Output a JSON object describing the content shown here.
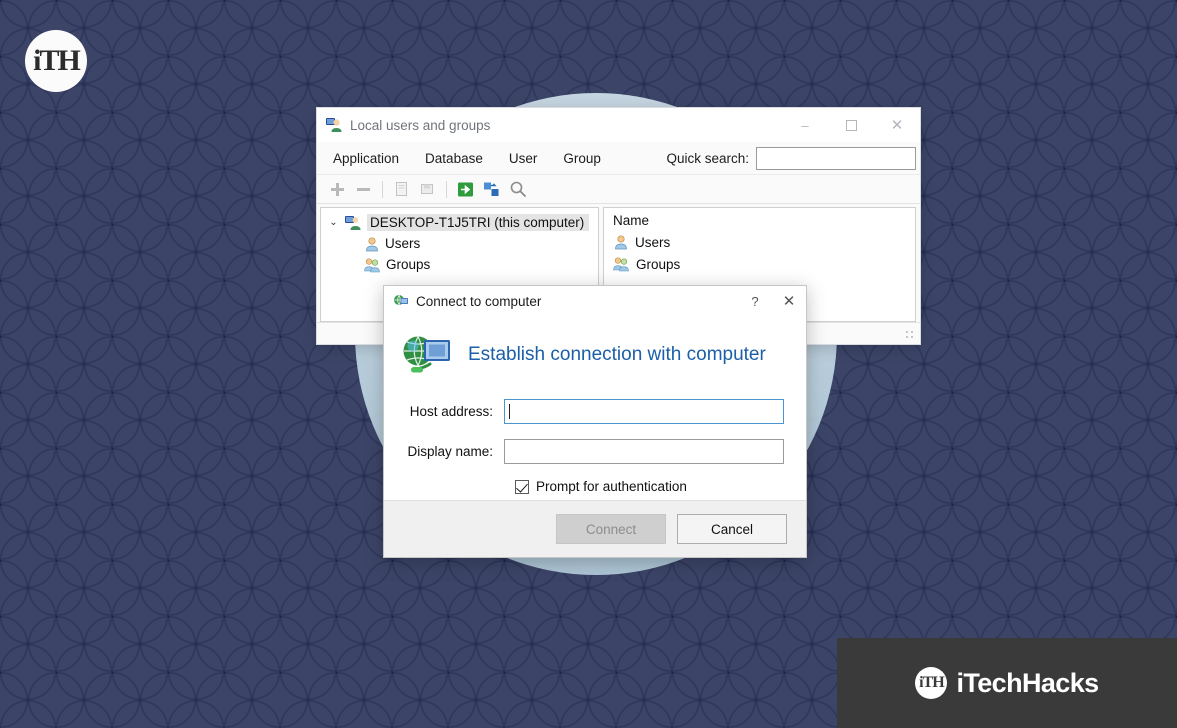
{
  "wallpaper": {
    "base_color": "#3c4568",
    "pattern_color": "#182038",
    "halo_color": "#cfe0ea"
  },
  "corner_logo": {
    "text": "iTH",
    "name": "itechhacks-round-logo"
  },
  "watermark": {
    "mark_text": "iTH",
    "text": "iTechHacks",
    "bar_color": "#3a3a3a"
  },
  "window": {
    "title": "Local users and groups",
    "app_icon": "users-and-groups-icon",
    "controls": {
      "minimize": "–",
      "maximize": "☐",
      "close": "✕"
    },
    "menu": [
      {
        "label": "Application"
      },
      {
        "label": "Database"
      },
      {
        "label": "User"
      },
      {
        "label": "Group"
      }
    ],
    "quick_search": {
      "label": "Quick search:",
      "value": "",
      "placeholder": ""
    },
    "toolbar": [
      {
        "name": "add-icon",
        "glyph": "✚",
        "enabled": false
      },
      {
        "name": "remove-icon",
        "glyph": "➖",
        "enabled": false
      },
      {
        "name": "separator-1",
        "glyph": "",
        "enabled": false
      },
      {
        "name": "new-document-icon",
        "glyph": "",
        "enabled": false
      },
      {
        "name": "save-document-icon",
        "glyph": "",
        "enabled": false
      },
      {
        "name": "separator-2",
        "glyph": "",
        "enabled": false
      },
      {
        "name": "connect-icon",
        "glyph": "→",
        "enabled": true
      },
      {
        "name": "refresh-icon",
        "glyph": "",
        "enabled": true
      },
      {
        "name": "search-icon",
        "glyph": "⚲",
        "enabled": true
      }
    ],
    "tree": {
      "root": {
        "label": "DESKTOP-T1J5TRI (this computer)",
        "icon": "computer-users-icon",
        "expanded": true,
        "selected": true,
        "chevron": "⌄"
      },
      "children": [
        {
          "label": "Users",
          "icon": "user-icon"
        },
        {
          "label": "Groups",
          "icon": "group-icon"
        }
      ]
    },
    "list": {
      "header": "Name",
      "rows": [
        {
          "label": "Users",
          "icon": "user-icon"
        },
        {
          "label": "Groups",
          "icon": "group-icon"
        }
      ]
    },
    "statusbar": {
      "text": "",
      "grip": "resize-grip"
    }
  },
  "dialog": {
    "title": "Connect to computer",
    "title_icon": "connect-computer-icon",
    "help_button": "?",
    "close_button": "✕",
    "banner": {
      "icon": "globe-monitor-icon",
      "headline": "Establish connection with computer",
      "headline_color": "#1b5fa8"
    },
    "fields": [
      {
        "label": "Host address:",
        "value": "",
        "focused": true,
        "name": "host-address-field"
      },
      {
        "label": "Display name:",
        "value": "",
        "focused": false,
        "name": "display-name-field"
      }
    ],
    "checkbox": {
      "label": "Prompt for authentication",
      "checked": true
    },
    "buttons": [
      {
        "label": "Connect",
        "state": "disabled",
        "name": "connect-button"
      },
      {
        "label": "Cancel",
        "state": "normal",
        "name": "cancel-button"
      }
    ]
  }
}
